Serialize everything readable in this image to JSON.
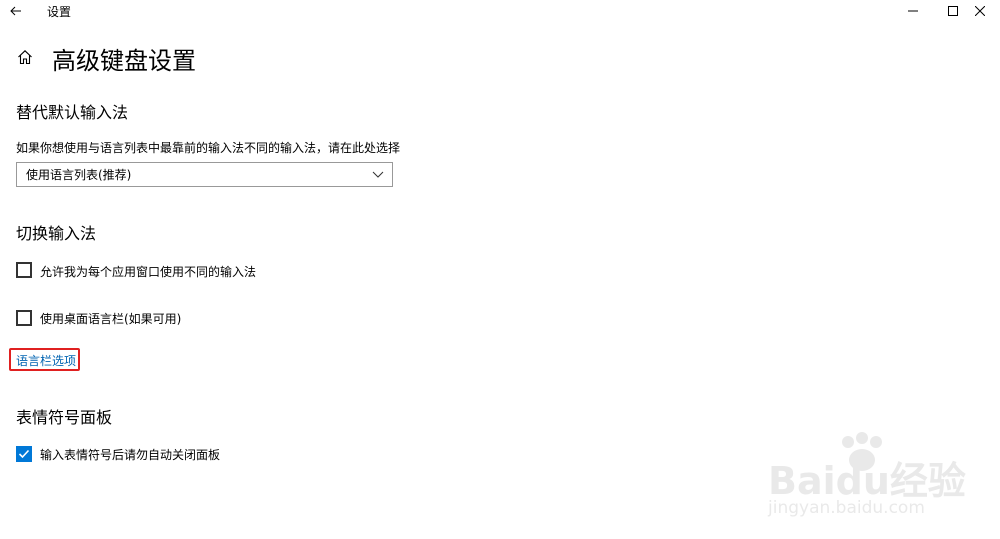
{
  "window": {
    "title": "设置"
  },
  "page": {
    "title": "高级键盘设置"
  },
  "sections": {
    "override": {
      "title": "替代默认输入法",
      "description": "如果你想使用与语言列表中最靠前的输入法不同的输入法，请在此处选择",
      "dropdown_value": "使用语言列表(推荐)"
    },
    "switch": {
      "title": "切换输入法",
      "checkbox1_label": "允许我为每个应用窗口使用不同的输入法",
      "checkbox1_checked": false,
      "checkbox2_label": "使用桌面语言栏(如果可用)",
      "checkbox2_checked": false,
      "link_label": "语言栏选项"
    },
    "emoji": {
      "title": "表情符号面板",
      "checkbox_label": "输入表情符号后请勿自动关闭面板",
      "checkbox_checked": true
    }
  },
  "watermark": {
    "brand": "Baidu经验",
    "url": "jingyan.baidu.com"
  },
  "colors": {
    "accent": "#0078d7",
    "link": "#0063b1",
    "highlight": "#e02020"
  }
}
